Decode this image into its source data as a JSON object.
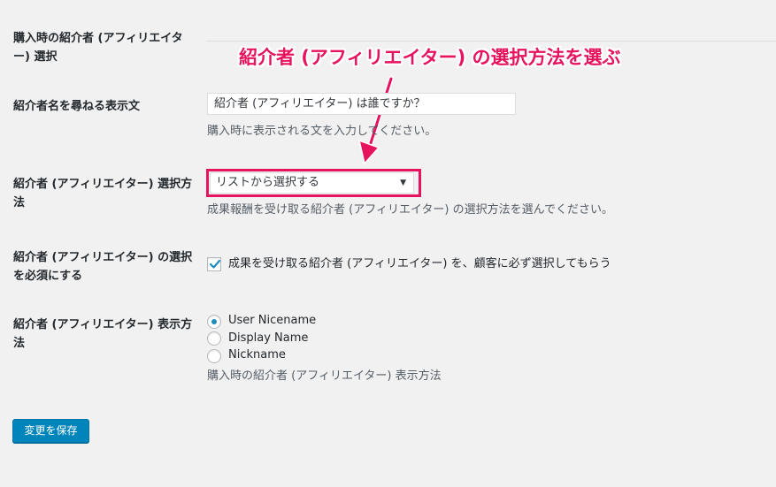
{
  "annotation": {
    "text": "紹介者 (アフィリエイター) の選択方法を選ぶ",
    "color": "#e6145f"
  },
  "fields": {
    "purchase_select": {
      "label": "購入時の紹介者 (アフィリエイター) 選択"
    },
    "prompt_text": {
      "label": "紹介者名を尋ねる表示文",
      "value": "紹介者 (アフィリエイター) は誰ですか？",
      "description": "購入時に表示される文を入力してください。"
    },
    "select_method": {
      "label": "紹介者 (アフィリエイター) 選択方法",
      "selected": "リストから選択する",
      "description": "成果報酬を受け取る紹介者 (アフィリエイター) の選択方法を選んでください。"
    },
    "required": {
      "label": "紹介者 (アフィリエイター) の選択を必須にする",
      "checkbox_label": "成果を受け取る紹介者 (アフィリエイター) を、顧客に必ず選択してもらう",
      "checked": true
    },
    "display_method": {
      "label": "紹介者 (アフィリエイター) 表示方法",
      "options": [
        {
          "label": "User Nicename",
          "checked": true
        },
        {
          "label": "Display Name",
          "checked": false
        },
        {
          "label": "Nickname",
          "checked": false
        }
      ],
      "description": "購入時の紹介者 (アフィリエイター) 表示方法"
    }
  },
  "save_button": {
    "label": "変更を保存",
    "color": "#0085ba"
  }
}
